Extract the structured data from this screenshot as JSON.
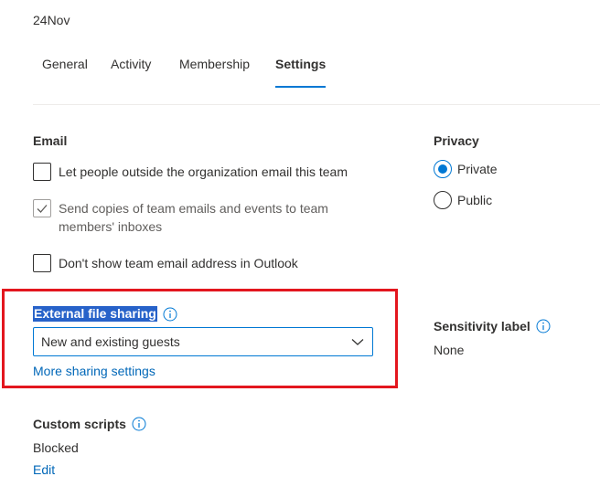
{
  "group_name": "24Nov",
  "tabs": [
    {
      "label": "General",
      "active": false
    },
    {
      "label": "Activity",
      "active": false
    },
    {
      "label": "Membership",
      "active": false
    },
    {
      "label": "Settings",
      "active": true
    }
  ],
  "email": {
    "title": "Email",
    "options": [
      {
        "label": "Let people outside the organization email this team",
        "checked": false,
        "disabled": false
      },
      {
        "label_line1": "Send copies of team emails and events to team",
        "label_line2": "members' inboxes",
        "checked": true,
        "disabled": true
      },
      {
        "label": "Don't show team email address in Outlook",
        "checked": false,
        "disabled": false
      }
    ]
  },
  "privacy": {
    "title": "Privacy",
    "options": [
      {
        "label": "Private",
        "selected": true
      },
      {
        "label": "Public",
        "selected": false
      }
    ]
  },
  "external_sharing": {
    "title": "External file sharing",
    "selected_value": "New and existing guests",
    "more_link": "More sharing settings"
  },
  "sensitivity": {
    "title": "Sensitivity label",
    "value": "None"
  },
  "custom_scripts": {
    "title": "Custom scripts",
    "value": "Blocked",
    "edit_link": "Edit"
  },
  "colors": {
    "accent": "#0078d4",
    "link": "#0067b8",
    "highlight_box": "#e3161e",
    "selection": "#2762c9"
  }
}
